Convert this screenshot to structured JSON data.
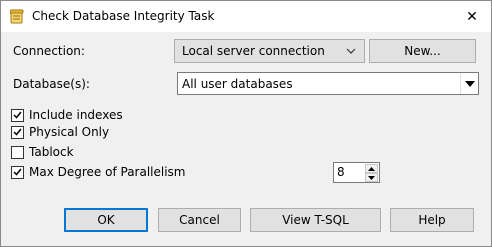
{
  "window": {
    "title": "Check Database Integrity Task",
    "close_glyph": "✕"
  },
  "form": {
    "connection_label": "Connection:",
    "connection_value": "Local server connection",
    "new_button": "New...",
    "databases_label": "Database(s):",
    "databases_value": "All user databases"
  },
  "options": [
    {
      "label": "Include indexes",
      "checked": true
    },
    {
      "label": "Physical Only",
      "checked": true
    },
    {
      "label": "Tablock",
      "checked": false
    },
    {
      "label": "Max Degree of Parallelism",
      "checked": true
    }
  ],
  "parallelism_value": "8",
  "buttons": {
    "ok": "OK",
    "cancel": "Cancel",
    "view_tsql": "View T-SQL",
    "help": "Help"
  },
  "icons": {
    "title": "task-scroll-icon",
    "close": "close-icon",
    "dropdown": "chevron-down-icon",
    "spin_up": "spin-up-icon",
    "spin_down": "spin-down-icon"
  },
  "colors": {
    "default_button_border": "#0078d7",
    "icon_gold": "#d4a017"
  }
}
